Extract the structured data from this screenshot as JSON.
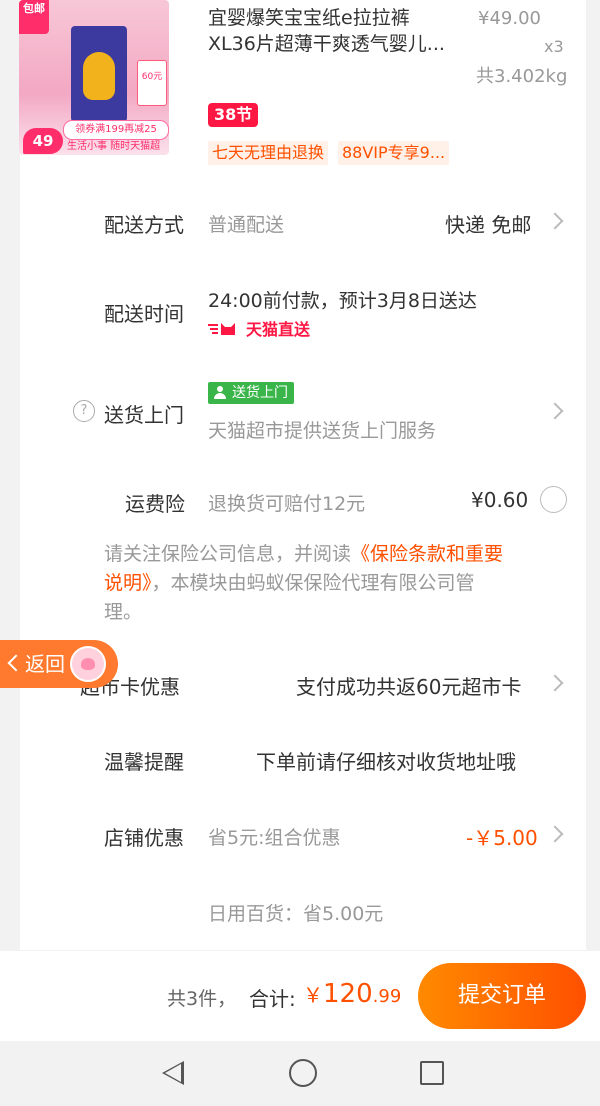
{
  "product": {
    "title_line1": "宜婴爆笑宝宝纸e拉拉裤",
    "title_line2": "XL36片超薄干爽透气婴儿...",
    "price": "¥49.00",
    "qty": "x3",
    "weight": "共3.402kg",
    "festival_badge": "38节",
    "tags": [
      "七天无理由退换",
      "88VIP专享9..."
    ],
    "image": {
      "baoyou": "包邮",
      "coupon": "领券满199再减25",
      "mini_price": "60元",
      "bubble_price": "49",
      "slogan": "生活小事 随时天猫超市!"
    }
  },
  "rows": {
    "delivery_method": {
      "label": "配送方式",
      "value": "普通配送",
      "right": "快递 免邮"
    },
    "delivery_time": {
      "label": "配送时间",
      "value": "24:00前付款，预计3月8日送达",
      "brand": "天猫直送"
    },
    "home_delivery": {
      "label": "送货上门",
      "tag": "送货上门",
      "desc": "天猫超市提供送货上门服务"
    },
    "freight_insurance": {
      "label": "运费险",
      "desc": "退换货可赔付12元",
      "price": "¥0.60"
    },
    "notice": {
      "prefix": "请关注保险公司信息，并阅读",
      "link_line1": "《保险条款和重要",
      "link_line2": "说明》",
      "suffix_line2": "，本模块由蚂蚁保保险代理有限公司管",
      "suffix_line3": "理。"
    },
    "card_discount": {
      "label": "超市卡优惠",
      "value": "支付成功共返60元超市卡"
    },
    "reminder": {
      "label": "温馨提醒",
      "value": "下单前请仔细核对收货地址哦"
    },
    "shop_discount": {
      "label": "店铺优惠",
      "desc": "省5元:组合优惠",
      "value": "-￥5.00"
    },
    "daily_goods": "日用百货：省5.00元"
  },
  "back_button": {
    "label": "返回"
  },
  "bottom": {
    "count": "共3件，",
    "total_label": "合计:",
    "currency": "￥",
    "total_int": "120",
    "total_dec": ".99",
    "submit": "提交订单"
  },
  "colors": {
    "accent": "#ff5000",
    "green": "#3ab54a",
    "red": "#ff1744"
  }
}
